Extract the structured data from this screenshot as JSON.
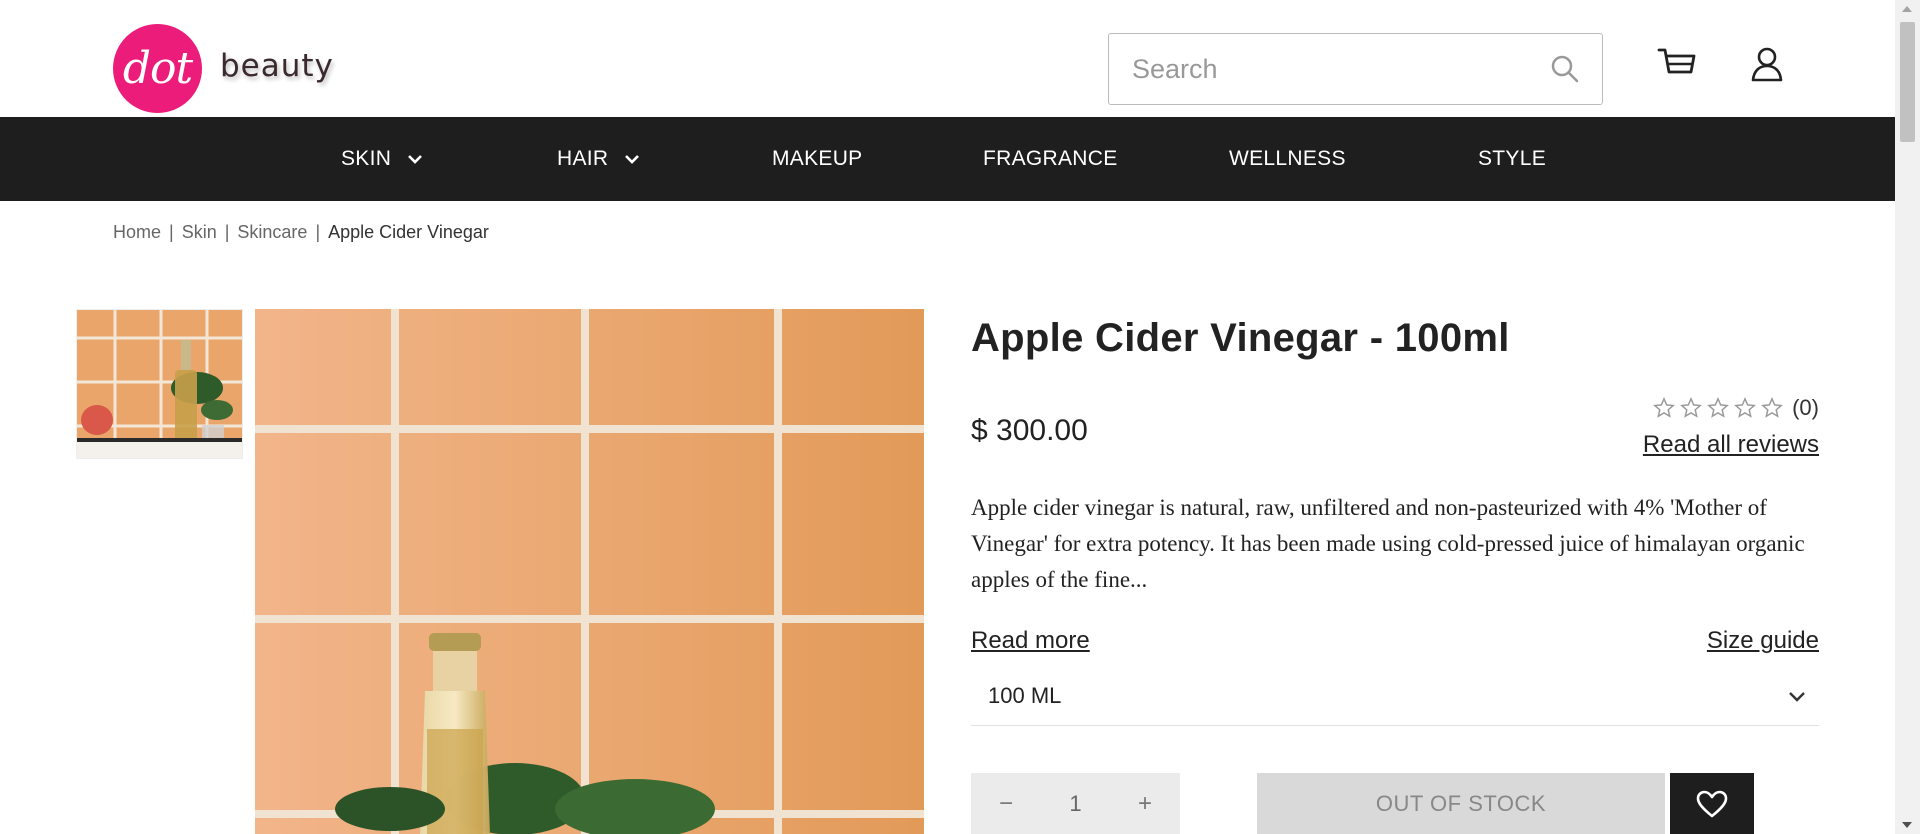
{
  "brand": {
    "logo_text": "dot",
    "name": "beauty",
    "logo_color": "#ec1c7a"
  },
  "search": {
    "placeholder": "Search",
    "value": ""
  },
  "icons": {
    "search": "search-icon",
    "cart": "cart-icon",
    "account": "user-icon",
    "wishlist": "heart-icon"
  },
  "nav": {
    "background": "#1e1e1e",
    "items": [
      {
        "label": "SKIN",
        "has_dropdown": true
      },
      {
        "label": "HAIR",
        "has_dropdown": true
      },
      {
        "label": "MAKEUP",
        "has_dropdown": false
      },
      {
        "label": "FRAGRANCE",
        "has_dropdown": false
      },
      {
        "label": "WELLNESS",
        "has_dropdown": false
      },
      {
        "label": "STYLE",
        "has_dropdown": false
      }
    ]
  },
  "breadcrumb": {
    "items": [
      "Home",
      "Skin",
      "Skincare"
    ],
    "current": "Apple Cider Vinegar",
    "separator": "|"
  },
  "product": {
    "title": "Apple Cider Vinegar - 100ml",
    "price": "$ 300.00",
    "rating": {
      "stars": 0,
      "max": 5,
      "count_label": "(0)"
    },
    "reviews_link": "Read all reviews",
    "description": "Apple cider vinegar is natural, raw, unfiltered and non-pasteurized with 4% 'Mother of Vinegar' for extra potency. It has been made using cold-pressed juice of himalayan organic apples of the fine...",
    "read_more": "Read more",
    "size_guide": "Size guide",
    "size": {
      "selected": "100 ML"
    },
    "quantity": {
      "minus": "−",
      "value": "1",
      "plus": "+"
    },
    "stock_button": "OUT OF STOCK"
  }
}
